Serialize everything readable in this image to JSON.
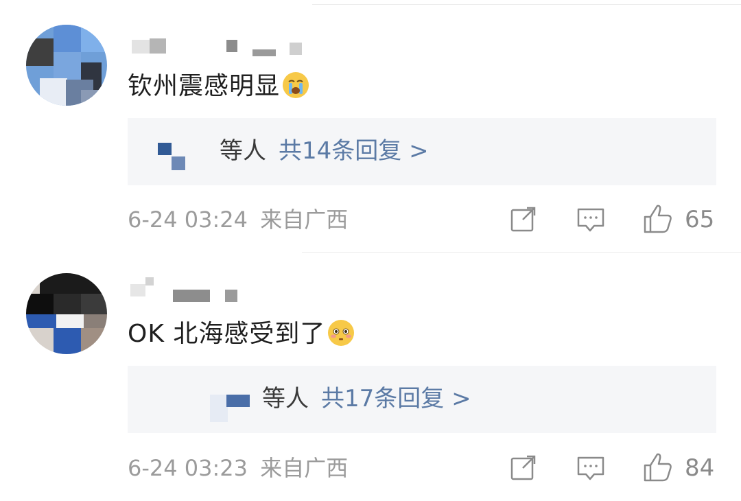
{
  "comments": [
    {
      "text": "钦州震感明显",
      "emoji": "crying-emoji",
      "reply_prefix": "等人",
      "reply_link": "共14条回复 >",
      "time": "6-24 03:24",
      "location": "来自广西",
      "likes": "65"
    },
    {
      "text": "OK 北海感受到了",
      "emoji": "flushed-emoji",
      "reply_prefix": "等人",
      "reply_link": "共17条回复 >",
      "time": "6-24 03:23",
      "location": "来自广西",
      "likes": "84"
    }
  ],
  "icons": {
    "share": "share-icon",
    "comment": "comment-icon",
    "like": "thumbs-up-icon"
  },
  "colors": {
    "link": "#5b7aa5",
    "meta": "#9b9b9b",
    "reply_bg": "#f5f6f8"
  }
}
